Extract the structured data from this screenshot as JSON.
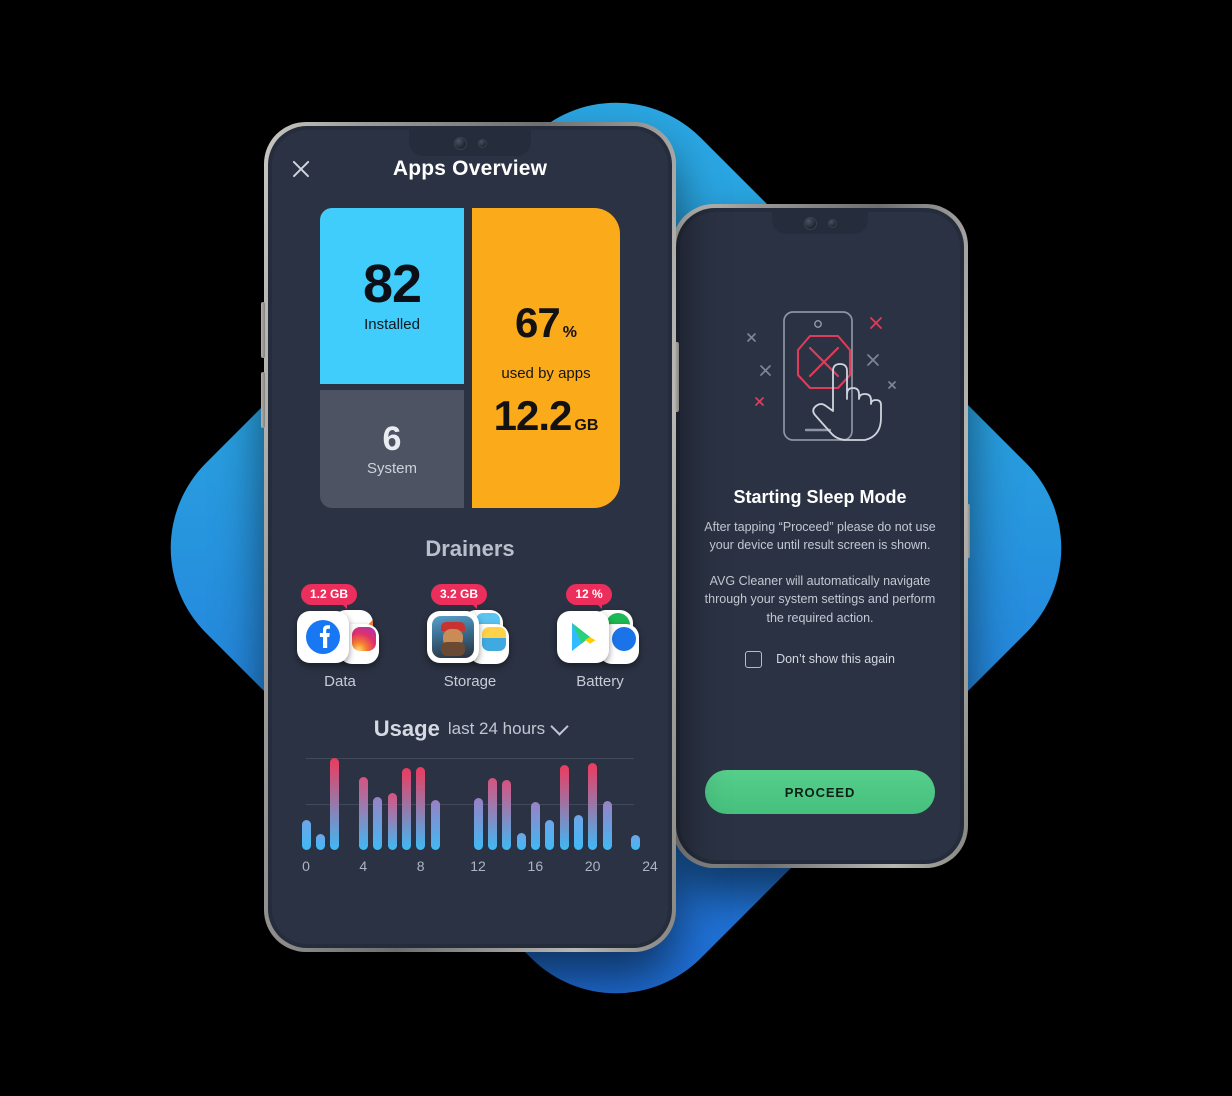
{
  "background": {
    "diamond_color_light": "#2BA8E4",
    "diamond_color_dark": "#1E6AD6"
  },
  "phone1": {
    "header": {
      "close_icon": "close-icon",
      "title": "Apps Overview"
    },
    "cards": {
      "installed": {
        "value": "82",
        "label": "Installed",
        "color": "#40CDFB"
      },
      "system": {
        "value": "6",
        "label": "System",
        "color": "#4D5362"
      },
      "used": {
        "percent": "67",
        "percent_unit": "%",
        "caption": "used by apps",
        "size": "12.2",
        "size_unit": "GB",
        "color": "#FBAA19"
      }
    },
    "drainers": {
      "title": "Drainers",
      "items": [
        {
          "badge": "1.2 GB",
          "name": "Data",
          "icon": "facebook-icon"
        },
        {
          "badge": "3.2 GB",
          "name": "Storage",
          "icon": "game-app-icon"
        },
        {
          "badge": "12 %",
          "name": "Battery",
          "icon": "play-store-icon"
        }
      ],
      "badge_color": "#EC2E5C"
    },
    "usage": {
      "title": "Usage",
      "range_label": "last 24 hours",
      "chevron_icon": "chevron-down-icon"
    }
  },
  "chart_data": {
    "type": "bar",
    "title": "Usage",
    "subtitle": "last 24 hours",
    "xlabel": "",
    "ylabel": "",
    "grid": true,
    "gridlines": [
      0.5,
      1.0
    ],
    "xlim": [
      0,
      24
    ],
    "ylim": [
      0,
      1
    ],
    "xticks": [
      0,
      4,
      8,
      12,
      16,
      20,
      24
    ],
    "xtick_labels": [
      "0",
      "4",
      "8",
      "12",
      "16",
      "20",
      "24"
    ],
    "x": [
      0,
      1,
      2,
      3,
      4,
      5,
      6,
      7,
      8,
      9,
      11,
      12,
      13,
      14,
      15,
      16,
      17,
      18,
      19,
      20,
      21,
      23
    ],
    "values": [
      0.33,
      0.17,
      1.0,
      0.0,
      0.79,
      0.58,
      0.62,
      0.89,
      0.9,
      0.54,
      0.0,
      0.57,
      0.78,
      0.76,
      0.19,
      0.52,
      0.33,
      0.92,
      0.38,
      0.95,
      0.53,
      0.16
    ],
    "bar_gradient_top": "#ED3A5E",
    "bar_gradient_bottom": "#3FB9F5"
  },
  "phone2": {
    "illustration": "phone-tap-blocked-icon",
    "title": "Starting Sleep Mode",
    "paragraph1": "After tapping “Proceed” please do not use your device until result screen is shown.",
    "paragraph2": "AVG Cleaner will automatically navigate through your system settings and perform the required action.",
    "checkbox_label": "Don’t show this again",
    "checkbox_checked": false,
    "button_label": "PROCEED",
    "button_color": "#4EC786"
  }
}
